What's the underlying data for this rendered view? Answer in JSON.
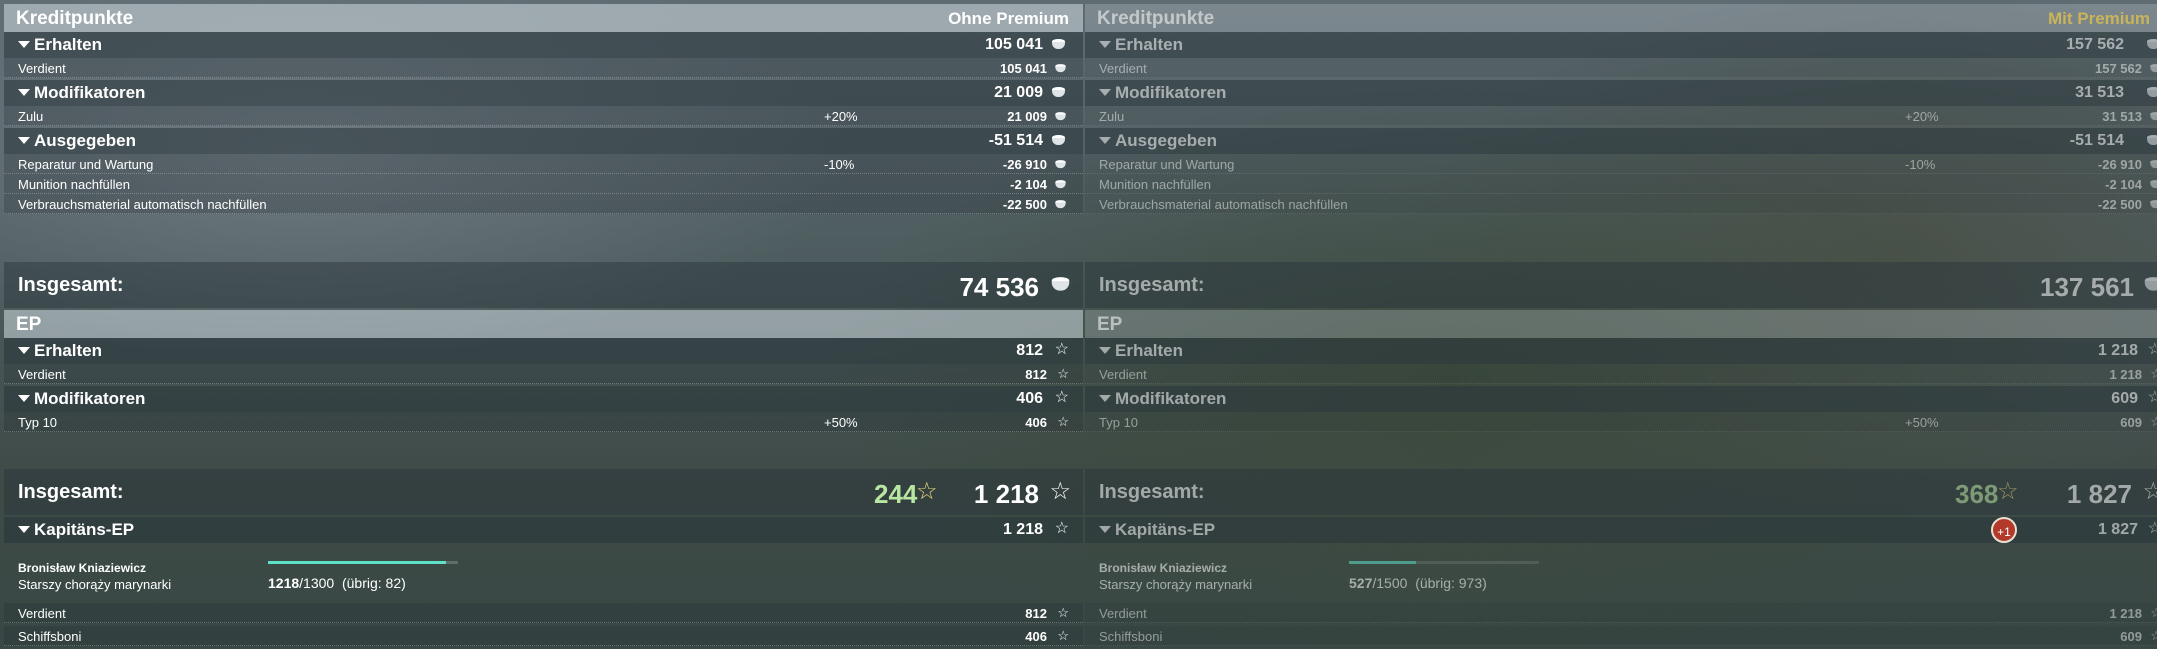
{
  "left": {
    "credits_header": "Kreditpunkte",
    "premium_label": "Ohne Premium",
    "earned": {
      "label": "Erhalten",
      "value": "105 041",
      "item_label": "Verdient",
      "item_value": "105 041"
    },
    "modifiers": {
      "label": "Modifikatoren",
      "value": "21 009",
      "item_label": "Zulu",
      "item_pct": "+20%",
      "item_value": "21 009"
    },
    "spent": {
      "label": "Ausgegeben",
      "value": "-51 514",
      "items": [
        {
          "label": "Reparatur und Wartung",
          "pct": "-10%",
          "value": "-26 910"
        },
        {
          "label": "Munition nachfüllen",
          "pct": "",
          "value": "-2 104"
        },
        {
          "label": "Verbrauchsmaterial automatisch nachfüllen",
          "pct": "",
          "value": "-22 500"
        }
      ]
    },
    "credits_total": {
      "label": "Insgesamt:",
      "value": "74 536"
    },
    "xp_header": "EP",
    "xp_earned": {
      "label": "Erhalten",
      "value": "812",
      "item_label": "Verdient",
      "item_value": "812"
    },
    "xp_modifiers": {
      "label": "Modifikatoren",
      "value": "406",
      "item_label": "Typ 10",
      "item_pct": "+50%",
      "item_value": "406"
    },
    "xp_total": {
      "label": "Insgesamt:",
      "free_xp": "244",
      "value": "1 218"
    },
    "captain": {
      "label": "Kapitäns-EP",
      "value": "1 218",
      "name": "Bronisław Kniaziewicz",
      "rank": "Starszy chorąży marynarki",
      "progress_current": "1218",
      "progress_total": "/1300",
      "progress_remaining": "(übrig: 82)",
      "progress_fraction": 0.937,
      "earned_label": "Verdient",
      "earned_value": "812",
      "bonus_label": "Schiffsboni",
      "bonus_value": "406"
    }
  },
  "right": {
    "credits_header": "Kreditpunkte",
    "premium_label": "Mit Premium",
    "earned": {
      "label": "Erhalten",
      "value": "157 562",
      "item_label": "Verdient",
      "item_value": "157 562"
    },
    "modifiers": {
      "label": "Modifikatoren",
      "value": "31 513",
      "item_label": "Zulu",
      "item_pct": "+20%",
      "item_value": "31 513"
    },
    "spent": {
      "label": "Ausgegeben",
      "value": "-51 514",
      "items": [
        {
          "label": "Reparatur und Wartung",
          "pct": "-10%",
          "value": "-26 910"
        },
        {
          "label": "Munition nachfüllen",
          "pct": "",
          "value": "-2 104"
        },
        {
          "label": "Verbrauchsmaterial automatisch nachfüllen",
          "pct": "",
          "value": "-22 500"
        }
      ]
    },
    "credits_total": {
      "label": "Insgesamt:",
      "value": "137 561"
    },
    "xp_header": "EP",
    "xp_earned": {
      "label": "Erhalten",
      "value": "1 218",
      "item_label": "Verdient",
      "item_value": "1 218"
    },
    "xp_modifiers": {
      "label": "Modifikatoren",
      "value": "609",
      "item_label": "Typ 10",
      "item_pct": "+50%",
      "item_value": "609"
    },
    "xp_total": {
      "label": "Insgesamt:",
      "free_xp": "368",
      "value": "1 827"
    },
    "captain": {
      "label": "Kapitäns-EP",
      "value": "1 827",
      "badge": "+1",
      "name": "Bronisław Kniaziewicz",
      "rank": "Starszy chorąży marynarki",
      "progress_current": "527",
      "progress_total": "/1500",
      "progress_remaining": "(übrig: 973)",
      "progress_fraction": 0.351,
      "earned_label": "Verdient",
      "earned_value": "1 218",
      "bonus_label": "Schiffsboni",
      "bonus_value": "609"
    }
  }
}
